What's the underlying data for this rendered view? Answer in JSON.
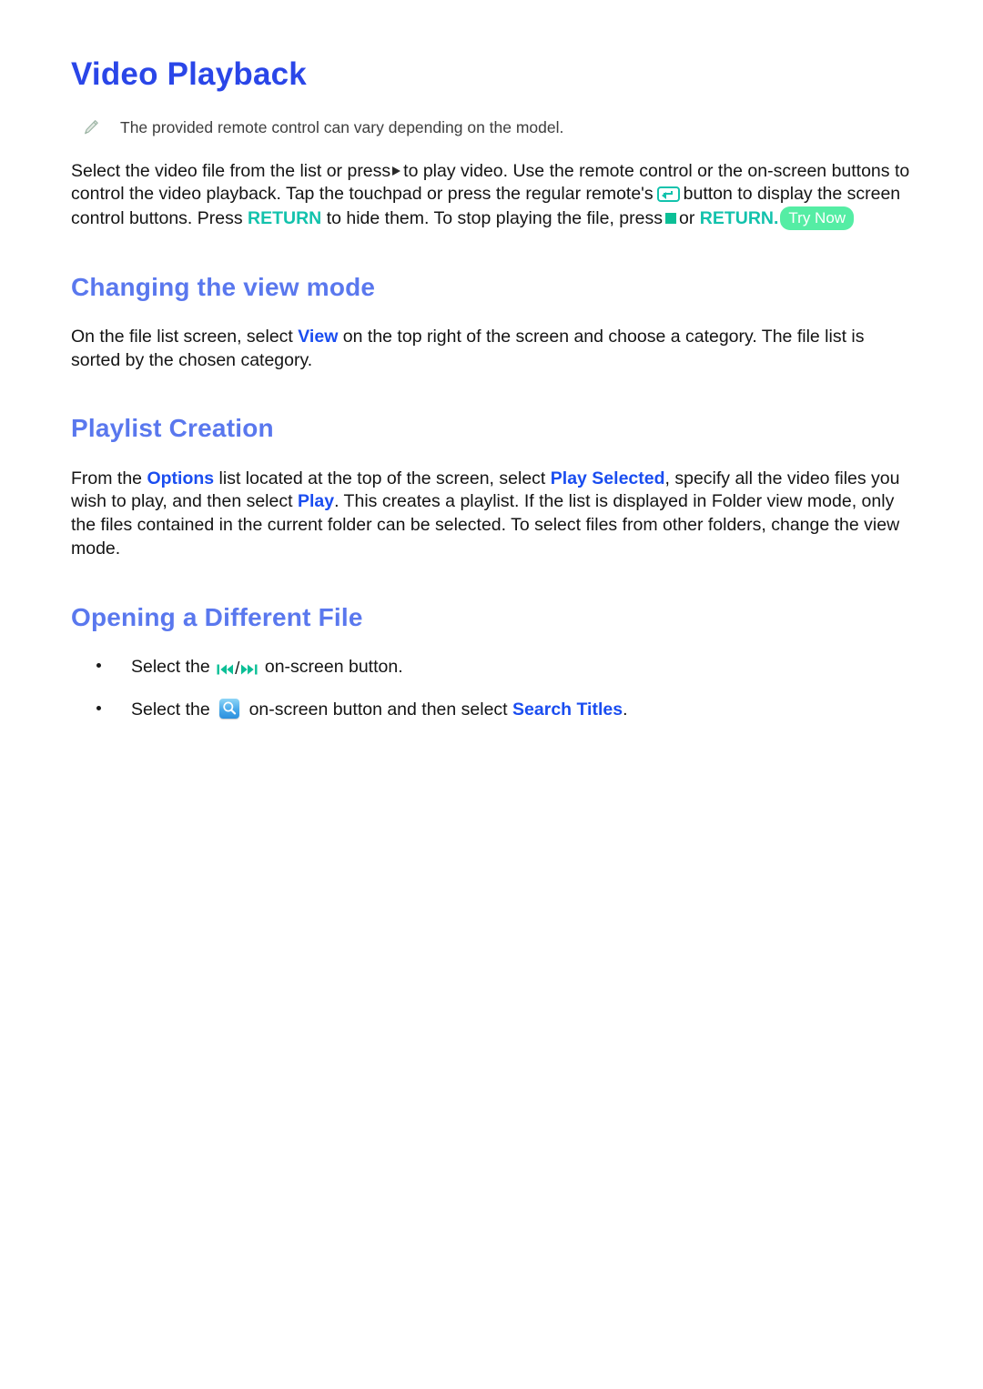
{
  "document": {
    "title": "Video Playback"
  },
  "note": {
    "icon": "pencil-note-icon",
    "text": "The provided remote control can vary depending on the model."
  },
  "intro": {
    "seg1": "Select the video file from the list or press",
    "play_icon": "play-triangle-icon",
    "seg2": "to play video. Use the remote control or the on-screen buttons to control the video playback. Tap the touchpad or press the regular remote's",
    "return_icon": "return-key-icon",
    "seg3": "button to display the screen control buttons. Press",
    "kw_return_1": "RETURN",
    "seg4": "to hide them. To stop playing the file, press",
    "stop_icon": "stop-square-icon",
    "seg5": "or",
    "kw_return_2": "RETURN",
    "seg6": ".",
    "try_now": "Try Now"
  },
  "sections": [
    {
      "heading": "Changing the view mode",
      "body": {
        "seg1": "On the file list screen, select",
        "kw1": "View",
        "seg2": "on the top right of the screen and choose a category. The file list is sorted by the chosen category."
      }
    },
    {
      "heading": "Playlist Creation",
      "body": {
        "seg1": "From the",
        "kw1": "Options",
        "seg2": "list located at the top of the screen, select",
        "kw2": "Play Selected",
        "seg3": ", specify all the video files you wish to play, and then select",
        "kw3": "Play",
        "seg4": ". This creates a playlist. If the list is displayed in Folder view mode, only the files contained in the current folder can be selected. To select files from other folders, change the view mode."
      }
    },
    {
      "heading": "Opening a Different File",
      "bullets": [
        {
          "seg1": "Select the",
          "icon_prev": "previous-track-icon",
          "separator": "/",
          "icon_next": "next-track-icon",
          "seg2": "on-screen button."
        },
        {
          "seg1": "Select the",
          "icon_search": "search-button-icon",
          "seg2": "on-screen button and then select",
          "kw1": "Search Titles",
          "seg3": "."
        }
      ]
    }
  ],
  "colors": {
    "title_blue": "#2a46e8",
    "heading_blue": "#5a78ee",
    "keyword_blue": "#1a4df0",
    "keyword_teal": "#12c2ac",
    "badge_green": "#55eda4"
  }
}
